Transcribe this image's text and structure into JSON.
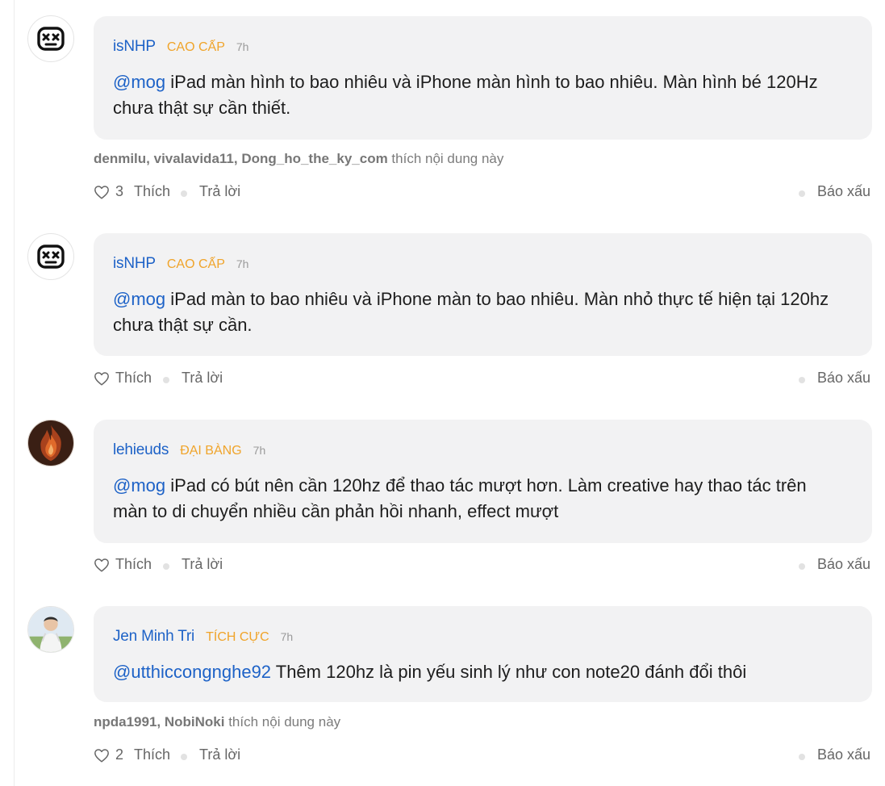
{
  "comments": [
    {
      "username": "isNHP",
      "rank": "CAO CẤP",
      "time": "7h",
      "avatar": "face-x-eyes-icon",
      "mention": "@mog",
      "text": " iPad màn hình to bao nhiêu và iPhone màn hình to bao nhiêu. Màn hình bé 120Hz chưa thật sự cần thiết.",
      "likers_names": "denmilu, vivalavida11, Dong_ho_the_ky_com",
      "likers_suffix": " thích nội dung này",
      "like_count": "3",
      "like_label": "Thích",
      "reply_label": "Trả lời",
      "report_label": "Báo xấu"
    },
    {
      "username": "isNHP",
      "rank": "CAO CẤP",
      "time": "7h",
      "avatar": "face-x-eyes-icon",
      "mention": "@mog",
      "text": " iPad màn to bao nhiêu và iPhone màn to bao nhiêu. Màn nhỏ thực tế hiện tại 120hz chưa thật sự cần.",
      "likers_names": "",
      "likers_suffix": "",
      "like_count": "",
      "like_label": "Thích",
      "reply_label": "Trả lời",
      "report_label": "Báo xấu"
    },
    {
      "username": "lehieuds",
      "rank": "ĐẠI BÀNG",
      "time": "7h",
      "avatar": "flame-avatar",
      "mention": "@mog",
      "text": " iPad có bút nên cần 120hz để thao tác mượt hơn. Làm creative hay thao tác trên màn to di chuyển nhiều cần phản hồi nhanh, effect mượt",
      "likers_names": "",
      "likers_suffix": "",
      "like_count": "",
      "like_label": "Thích",
      "reply_label": "Trả lời",
      "report_label": "Báo xấu"
    },
    {
      "username": "Jen Minh Tri",
      "rank": "TÍCH CỰC",
      "time": "7h",
      "avatar": "user-photo-avatar",
      "mention": "@utthiccongnghe92",
      "text": " Thêm 120hz là pin yếu sinh lý như con note20 đánh đổi thôi",
      "likers_names": "npda1991, NobiNoki",
      "likers_suffix": " thích nội dung này",
      "like_count": "2",
      "like_label": "Thích",
      "reply_label": "Trả lời",
      "report_label": "Báo xấu"
    }
  ],
  "colors": {
    "username": "#1d62c7",
    "rank": "#f0a42a",
    "bubble": "#f2f2f3"
  }
}
